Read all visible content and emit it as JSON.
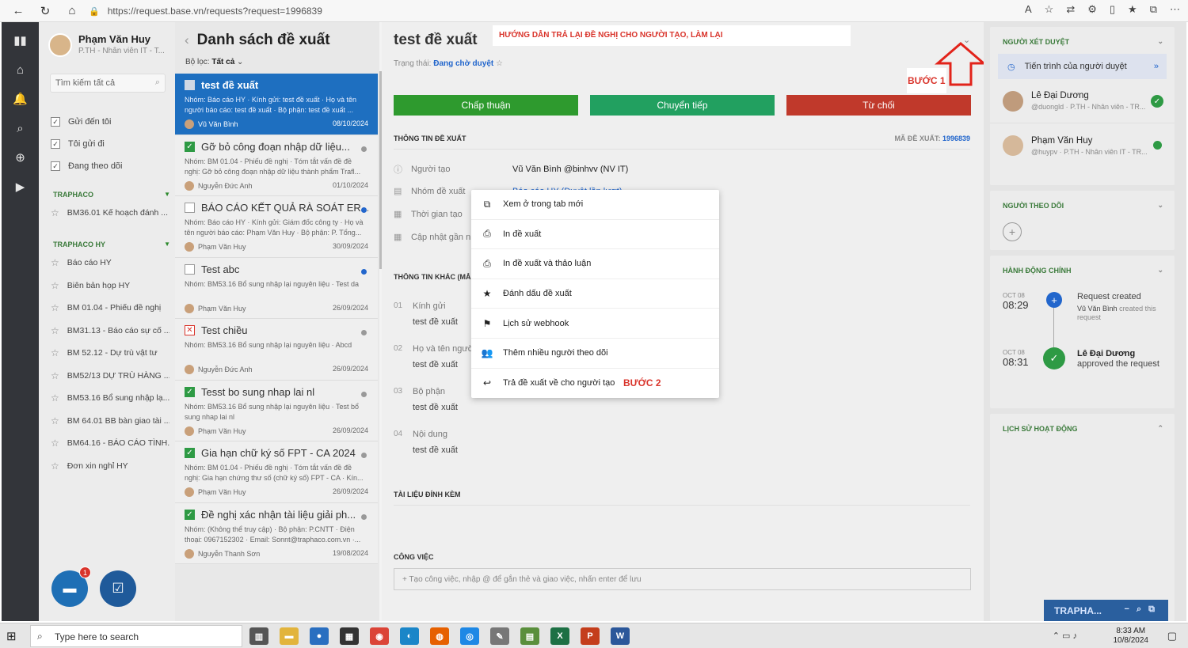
{
  "browser": {
    "url": "https://request.base.vn/requests?request=1996839"
  },
  "user": {
    "name": "Phạm Văn Huy",
    "subtitle": "P.TH - Nhân viên IT - T..."
  },
  "left": {
    "search_placeholder": "Tìm kiếm tất cả",
    "filters": [
      "Gửi đến tôi",
      "Tôi gửi đi",
      "Đang theo dõi"
    ],
    "group1": {
      "name": "TRAPHACO",
      "items": [
        "BM36.01 Kế hoạch đánh ..."
      ]
    },
    "group2": {
      "name": "TRAPHACO HY",
      "items": [
        "Báo cáo HY",
        "Biên bản họp HY",
        "BM 01.04 - Phiếu đề nghị",
        "BM31.13 - Báo cáo sự cố ...",
        "BM 52.12 - Dự trù vật tư",
        "BM52/13 DỰ TRÙ HÀNG ...",
        "BM53.16 Bổ sung nhập lạ...",
        "BM 64.01 BB bàn giao tài ...",
        "BM64.16 - BÁO CÁO TÌNH...",
        "Đơn xin nghỉ HY"
      ]
    },
    "chat_badge": "1"
  },
  "list": {
    "back": "‹",
    "title": "Danh sách đề xuất",
    "filter_label": "Bộ lọc:",
    "filter_value": "Tất cả",
    "items": [
      {
        "title": "test đề xuất",
        "desc": "Nhóm: Báo cáo HY · Kính gửi: test đề xuất · Họ và tên người báo cáo: test đề xuất · Bộ phận: test đề xuất ...",
        "author": "Vũ Văn Bình",
        "date": "08/10/2024"
      },
      {
        "title": "Gỡ bỏ công đoạn nhập dữ liệu...",
        "desc": "Nhóm: BM 01.04 - Phiếu đề nghị · Tóm tắt vấn đề đề nghị: Gỡ bỏ công đoạn nhập dữ liệu thành phẩm Trafl...",
        "author": "Nguyễn Đức Anh",
        "date": "01/10/2024"
      },
      {
        "title": "BÁO CÁO KẾT QUẢ RÀ SOÁT ER...",
        "desc": "Nhóm: Báo cáo HY · Kính gửi: Giám đốc công ty · Họ và tên người báo cáo: Phạm Văn Huy · Bộ phận: P. Tổng...",
        "author": "Phạm Văn Huy",
        "date": "30/09/2024"
      },
      {
        "title": "Test abc",
        "desc": "Nhóm: BM53.16 Bổ sung nhập lại nguyên liệu · Test da",
        "author": "Phạm Văn Huy",
        "date": "26/09/2024"
      },
      {
        "title": "Test chiều",
        "desc": "Nhóm: BM53.16 Bổ sung nhập lại nguyên liệu · Abcd",
        "author": "Nguyễn Đức Anh",
        "date": "26/09/2024"
      },
      {
        "title": "Tesst bo sung nhap lai nl",
        "desc": "Nhóm: BM53.16 Bổ sung nhập lại nguyên liệu · Test bổ sung nhap lai nl",
        "author": "Phạm Văn Huy",
        "date": "26/09/2024"
      },
      {
        "title": "Gia hạn chữ ký số FPT - CA 2024",
        "desc": "Nhóm: BM 01.04 - Phiếu đề nghị · Tóm tắt vấn đề đề nghị: Gia hạn chứng thư số (chữ ký số) FPT - CA · Kín...",
        "author": "Phạm Văn Huy",
        "date": "26/09/2024"
      },
      {
        "title": "Đề nghị xác nhận tài liệu giải ph...",
        "desc": "Nhóm: (Không thể truy cập) · Bộ phận: P.CNTT · Điện thoại: 0967152302 · Email: Sonnt@traphaco.com.vn ·...",
        "author": "Nguyễn Thanh Sơn",
        "date": "19/08/2024"
      }
    ]
  },
  "main": {
    "title": "test đề xuất",
    "guide": "HƯỚNG DẪN TRẢ LẠI ĐỀ NGHỊ CHO NGƯỜI TẠO, LÀM LẠI",
    "step1": "BƯỚC 1",
    "status_label": "Trạng thái:",
    "status_value": "Đang chờ duyệt",
    "actions": [
      "Chấp thuận",
      "Chuyển tiếp",
      "Từ chối"
    ],
    "info_title": "THÔNG TIN ĐỀ XUẤT",
    "code_label": "MÃ ĐỀ XUẤT:",
    "code_value": "1996839",
    "fields": [
      {
        "label": "Người tạo",
        "value": "Vũ Văn Bình @binhvv (NV IT)"
      },
      {
        "label": "Nhóm đề xuất",
        "value": "Báo cáo HY (Duyệt lần lượt)"
      },
      {
        "label": "Thời gian tạo",
        "value": ""
      },
      {
        "label": "Cập nhật gần nhất",
        "value": ""
      }
    ],
    "other_title": "THÔNG TIN KHÁC (MẪU)",
    "other_fields": [
      {
        "num": "01",
        "label": "Kính gửi",
        "value": "test đề xuất"
      },
      {
        "num": "02",
        "label": "Họ và tên người báo cáo",
        "value": "test đề xuất"
      },
      {
        "num": "03",
        "label": "Bộ phận",
        "value": "test đề xuất"
      },
      {
        "num": "04",
        "label": "Nội dung",
        "value": "test đề xuất"
      }
    ],
    "attach_title": "TÀI LIỆU ĐÍNH KÈM",
    "task_title": "CÔNG VIỆC",
    "task_placeholder": "+ Tạo công việc, nhập @ để gắn thẻ và giao việc, nhấn enter để lưu"
  },
  "menu": {
    "items": [
      "Xem ở trong tab mới",
      "In đề xuất",
      "In đề xuất và thảo luận",
      "Đánh dấu đề xuất",
      "Lịch sử webhook",
      "Thêm nhiều người theo dõi",
      "Trả đề xuất về cho người tạo"
    ],
    "step2": "BƯỚC 2"
  },
  "right": {
    "approvers_title": "NGƯỜI XÉT DUYỆT",
    "process_label": "Tiến trình của người duyệt",
    "approvers": [
      {
        "name": "Lê Đại Dương",
        "sub": "@duongld · P.TH - Nhân viên - TR..."
      },
      {
        "name": "Phạm Văn Huy",
        "sub": "@huypv · P.TH - Nhân viên IT - TR..."
      }
    ],
    "followers_title": "NGƯỜI THEO DÕI",
    "main_actions_title": "HÀNH ĐỘNG CHÍNH",
    "timeline": [
      {
        "month": "OCT 08",
        "time": "08:29",
        "title": "Request created",
        "who": "Vũ Văn Bình",
        "text": "created this request"
      },
      {
        "month": "OCT 08",
        "time": "08:31",
        "title": "Lê Đại Dương",
        "text": "approved the request"
      }
    ],
    "history_title": "LỊCH SỬ HOẠT ĐỘNG",
    "traph": "TRAPHA..."
  },
  "taskbar": {
    "search": "Type here to search",
    "time": "8:33 AM",
    "date": "10/8/2024"
  }
}
